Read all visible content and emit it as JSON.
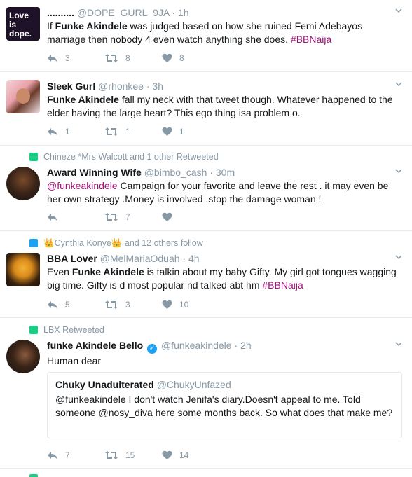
{
  "colors": {
    "link": "#a0127a",
    "meta": "#8899a6",
    "retweet_icon": "#19cf86",
    "follow_icon": "#1da1f2",
    "border": "#e6ecf0"
  },
  "tweets": [
    {
      "name": "..........",
      "handle": "@DOPE_GURL_9JA",
      "time": "1h",
      "avatar_text": "Love is dope.",
      "text_pre": "If ",
      "text_bold": "Funke Akindele",
      "text_post": " was judged based on how she ruined Femi Adebayos marriage then nobody 4 even watch anything she does. ",
      "hashtag": "#BBNaija",
      "reply_count": "3",
      "retweet_count": "8",
      "like_count": "8"
    },
    {
      "name": "Sleek Gurl",
      "handle": "@rhonkee",
      "time": "3h",
      "text_bold": "Funke Akindele",
      "text_post": " fall my neck with that tweet though. Whatever happened to the elder having the large heart? This ego thing isa problem o.",
      "reply_count": "1",
      "retweet_count": "1",
      "like_count": "1"
    },
    {
      "context": "Chineze *Mrs Walcott and 1 other Retweeted",
      "name": "Award Winning Wife",
      "handle": "@bimbo_cash",
      "time": "30m",
      "mention": "@funkeakindele",
      "text_post": " Campaign for your favorite and leave the rest . it may even be her own strategy .Money is involved .stop the damage woman !",
      "reply_count": "",
      "retweet_count": "7",
      "like_count": ""
    },
    {
      "context": "👑Cynthia Konye👑 and 12 others follow",
      "name": "BBA Lover",
      "handle": "@MelMariaOduah",
      "time": "4h",
      "text_pre": "Even ",
      "text_bold": "Funke Akindele",
      "text_post": " is talkin about my baby Gifty. My girl got tongues wagging big time. Gifty is d most popular nd talked abt hm ",
      "hashtag": "#BBNaija",
      "reply_count": "5",
      "retweet_count": "3",
      "like_count": "10"
    },
    {
      "context": "LBX Retweeted",
      "name": "funke Akindele Bello",
      "handle": "@funkeakindele",
      "time": "2h",
      "text": "Human dear",
      "quote": {
        "name": "Chuky Unadulterated",
        "handle": "@ChukyUnfazed",
        "text": "@funkeakindele I don't watch Jenifa's diary.Doesn't appeal to me. Told someone @nosy_diva here some months back. So what does that make me?"
      },
      "reply_count": "7",
      "retweet_count": "15",
      "like_count": "14"
    }
  ]
}
